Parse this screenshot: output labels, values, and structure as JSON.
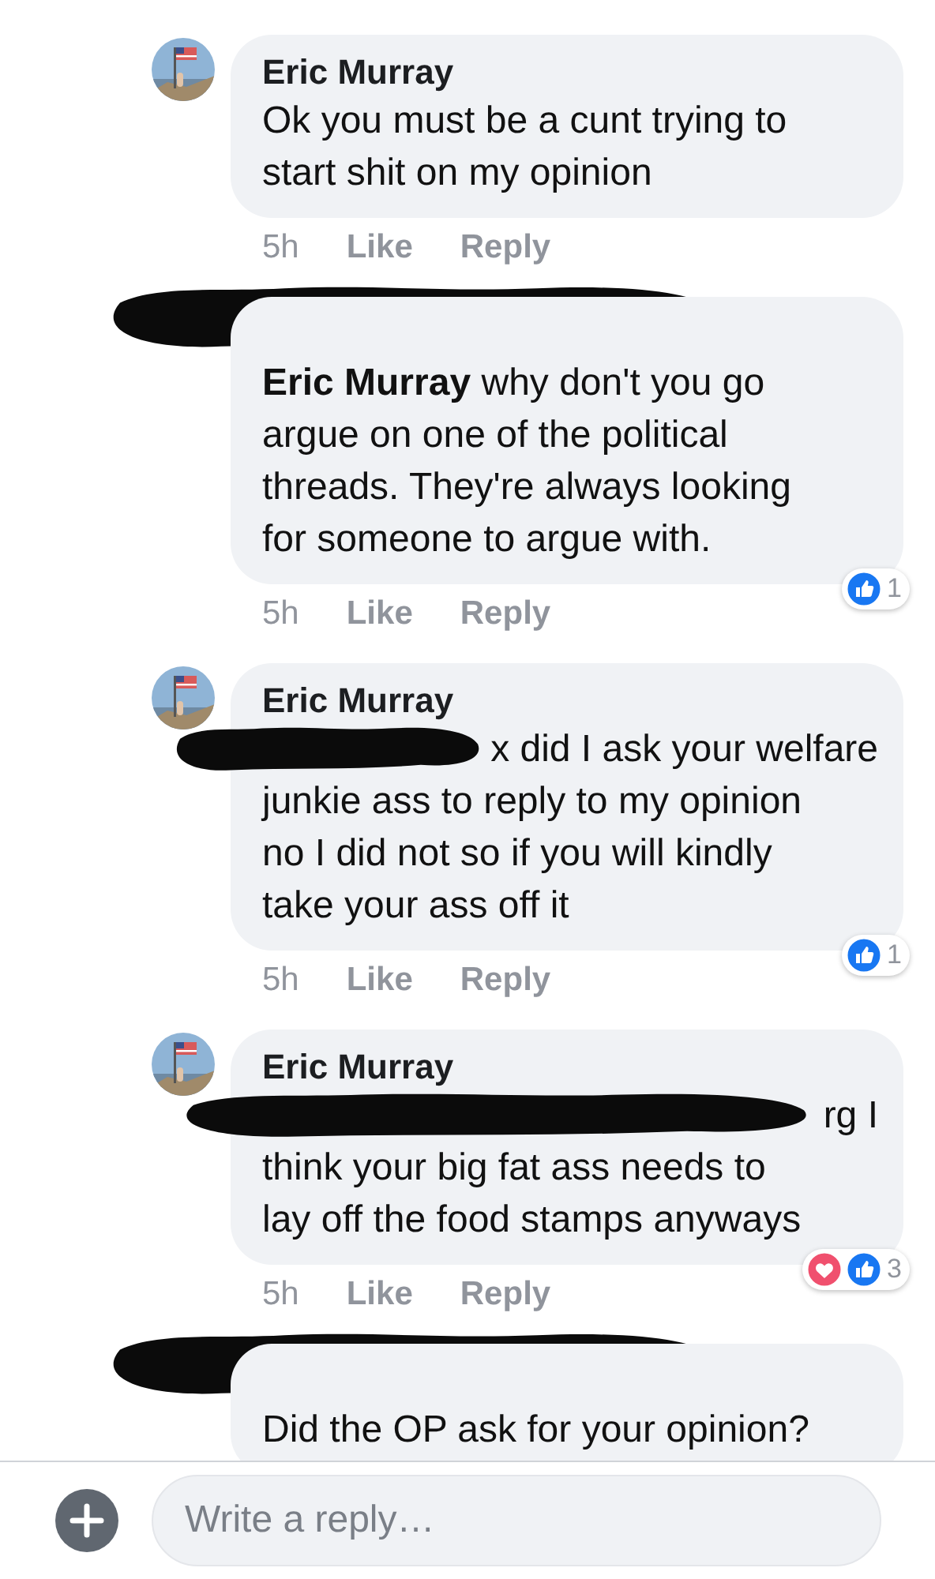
{
  "comments": [
    {
      "author": "Eric Murray",
      "author_redacted": false,
      "lead_redacted": false,
      "lines": [
        "Ok you must be a cunt trying to",
        "start shit on my opinion"
      ],
      "time": "5h",
      "like": "Like",
      "reply": "Reply"
    },
    {
      "author_redacted": true,
      "lead_redacted": false,
      "lines": [
        "**Eric Murray** why don't you go",
        "argue on one of the political",
        "threads. They're always looking",
        "for someone to argue with."
      ],
      "time": "5h",
      "like": "Like",
      "reply": "Reply",
      "reactions": [
        {
          "kind": "like"
        }
      ],
      "reaction_count": "1"
    },
    {
      "author": "Eric Murray",
      "author_redacted": false,
      "lead_redacted": true,
      "lines": [
        "x did I ask your welfare",
        "junkie ass to reply to my opinion",
        "no I did not so if you will kindly",
        "take your ass off it"
      ],
      "time": "5h",
      "like": "Like",
      "reply": "Reply",
      "reactions": [
        {
          "kind": "like"
        }
      ],
      "reaction_count": "1"
    },
    {
      "author": "Eric Murray",
      "author_redacted": false,
      "lead_redacted": true,
      "lines": [
        "rg I",
        "think your big fat ass needs to",
        "lay off the food stamps anyways"
      ],
      "time": "5h",
      "like": "Like",
      "reply": "Reply",
      "reactions": [
        {
          "kind": "love"
        },
        {
          "kind": "like"
        }
      ],
      "reaction_count": "3"
    },
    {
      "author_redacted": true,
      "lead_redacted": false,
      "lines": [
        "Did the OP ask for your opinion?"
      ]
    }
  ],
  "composer": {
    "placeholder": "Write a reply…"
  }
}
